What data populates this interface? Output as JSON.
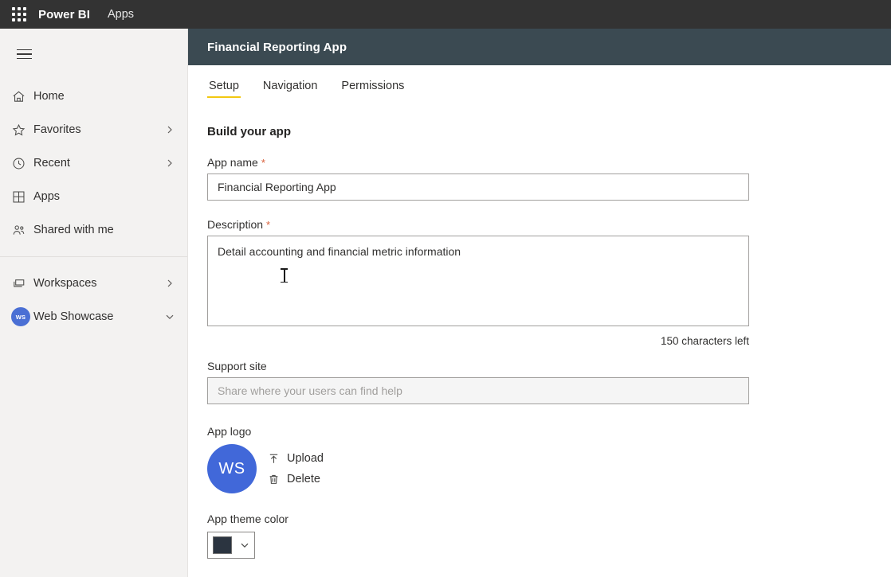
{
  "topbar": {
    "waffle_icon": "app-launcher-grid-icon",
    "brand": "Power BI",
    "nav_item": "Apps"
  },
  "sidebar": {
    "menu_icon": "hamburger-menu-icon",
    "groups": [
      {
        "items": [
          {
            "label": "Home",
            "icon": "home-icon",
            "chevron": ""
          },
          {
            "label": "Favorites",
            "icon": "star-icon",
            "chevron": "›"
          },
          {
            "label": "Recent",
            "icon": "clock-icon",
            "chevron": "›"
          },
          {
            "label": "Apps",
            "icon": "apps-grid-icon",
            "chevron": ""
          },
          {
            "label": "Shared with me",
            "icon": "people-icon",
            "chevron": ""
          }
        ]
      },
      {
        "items": [
          {
            "label": "Workspaces",
            "icon": "workspaces-icon",
            "chevron": "›"
          },
          {
            "label": "Web Showcase",
            "icon": "workspace-avatar",
            "avatar_initials": "WS",
            "chevron": "⌄"
          }
        ]
      }
    ]
  },
  "app_header": {
    "title": "Financial Reporting App"
  },
  "tabs": [
    {
      "label": "Setup",
      "active": true
    },
    {
      "label": "Navigation",
      "active": false
    },
    {
      "label": "Permissions",
      "active": false
    }
  ],
  "form": {
    "section_title": "Build your app",
    "app_name": {
      "label": "App name",
      "required_marker": "*",
      "value": "Financial Reporting App"
    },
    "description": {
      "label": "Description",
      "required_marker": "*",
      "value": "Detail accounting and financial metric information",
      "char_count": "150 characters left"
    },
    "support_site": {
      "label": "Support site",
      "placeholder": "Share where your users can find help",
      "value": ""
    },
    "app_logo": {
      "label": "App logo",
      "initials": "WS",
      "upload_label": "Upload",
      "upload_icon": "upload-arrow-icon",
      "delete_label": "Delete",
      "delete_icon": "trash-icon"
    },
    "app_theme_color": {
      "label": "App theme color",
      "value": "#2b3440",
      "chevron_icon": "chevron-down-icon"
    }
  },
  "colors": {
    "topbar_bg": "#333333",
    "app_header_bg": "#3b4a52",
    "sidebar_bg": "#f3f2f1",
    "accent_yellow": "#f2c811",
    "avatar_blue": "#4168d9",
    "required_red": "#d9603b"
  }
}
